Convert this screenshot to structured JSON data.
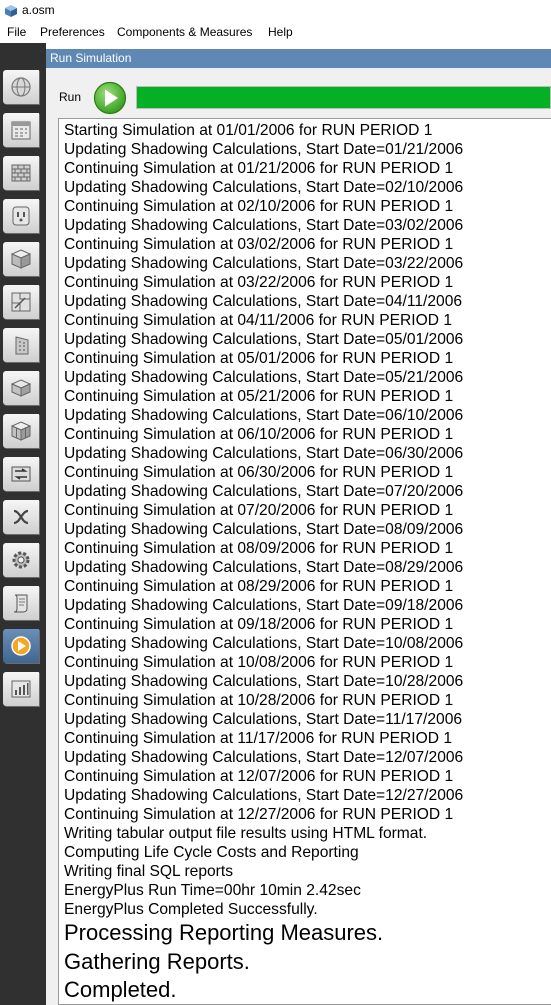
{
  "window": {
    "title": "a.osm",
    "icon": "openstudio-cube-icon"
  },
  "menubar": {
    "items": [
      "File",
      "Preferences",
      "Components & Measures",
      "Help"
    ]
  },
  "sidebar": {
    "items": [
      {
        "name": "site-tab",
        "icon": "globe-icon"
      },
      {
        "name": "schedules-tab",
        "icon": "calendar-icon"
      },
      {
        "name": "constructions-tab",
        "icon": "brick-wall-icon"
      },
      {
        "name": "loads-tab",
        "icon": "outlet-icon"
      },
      {
        "name": "space-types-tab",
        "icon": "space-type-cube-icon"
      },
      {
        "name": "geometry-tab",
        "icon": "floorplan-icon"
      },
      {
        "name": "facility-tab",
        "icon": "building-icon"
      },
      {
        "name": "spaces-tab",
        "icon": "space-cube-icon"
      },
      {
        "name": "thermal-zones-tab",
        "icon": "zone-cube-icon"
      },
      {
        "name": "hvac-systems-tab",
        "icon": "hvac-loop-icon"
      },
      {
        "name": "output-variables-tab",
        "icon": "variables-x-icon"
      },
      {
        "name": "simulation-settings-tab",
        "icon": "gear-icon"
      },
      {
        "name": "measures-tab",
        "icon": "scroll-icon"
      },
      {
        "name": "run-simulation-tab",
        "icon": "play-circle-icon",
        "active": true
      },
      {
        "name": "results-summary-tab",
        "icon": "bar-chart-icon"
      }
    ]
  },
  "panel": {
    "title": "Run Simulation"
  },
  "run": {
    "label": "Run",
    "button_icon": "play-icon",
    "progress_percent": 100,
    "progress_color": "#06b025"
  },
  "log": {
    "lines": [
      "Starting Simulation at 01/01/2006 for RUN PERIOD 1",
      "Updating Shadowing Calculations, Start Date=01/21/2006",
      "Continuing Simulation at 01/21/2006 for RUN PERIOD 1",
      "Updating Shadowing Calculations, Start Date=02/10/2006",
      "Continuing Simulation at 02/10/2006 for RUN PERIOD 1",
      "Updating Shadowing Calculations, Start Date=03/02/2006",
      "Continuing Simulation at 03/02/2006 for RUN PERIOD 1",
      "Updating Shadowing Calculations, Start Date=03/22/2006",
      "Continuing Simulation at 03/22/2006 for RUN PERIOD 1",
      "Updating Shadowing Calculations, Start Date=04/11/2006",
      "Continuing Simulation at 04/11/2006 for RUN PERIOD 1",
      "Updating Shadowing Calculations, Start Date=05/01/2006",
      "Continuing Simulation at 05/01/2006 for RUN PERIOD 1",
      "Updating Shadowing Calculations, Start Date=05/21/2006",
      "Continuing Simulation at 05/21/2006 for RUN PERIOD 1",
      "Updating Shadowing Calculations, Start Date=06/10/2006",
      "Continuing Simulation at 06/10/2006 for RUN PERIOD 1",
      "Updating Shadowing Calculations, Start Date=06/30/2006",
      "Continuing Simulation at 06/30/2006 for RUN PERIOD 1",
      "Updating Shadowing Calculations, Start Date=07/20/2006",
      "Continuing Simulation at 07/20/2006 for RUN PERIOD 1",
      "Updating Shadowing Calculations, Start Date=08/09/2006",
      "Continuing Simulation at 08/09/2006 for RUN PERIOD 1",
      "Updating Shadowing Calculations, Start Date=08/29/2006",
      "Continuing Simulation at 08/29/2006 for RUN PERIOD 1",
      "Updating Shadowing Calculations, Start Date=09/18/2006",
      "Continuing Simulation at 09/18/2006 for RUN PERIOD 1",
      "Updating Shadowing Calculations, Start Date=10/08/2006",
      "Continuing Simulation at 10/08/2006 for RUN PERIOD 1",
      "Updating Shadowing Calculations, Start Date=10/28/2006",
      "Continuing Simulation at 10/28/2006 for RUN PERIOD 1",
      "Updating Shadowing Calculations, Start Date=11/17/2006",
      "Continuing Simulation at 11/17/2006 for RUN PERIOD 1",
      "Updating Shadowing Calculations, Start Date=12/07/2006",
      "Continuing Simulation at 12/07/2006 for RUN PERIOD 1",
      "Updating Shadowing Calculations, Start Date=12/27/2006",
      "Continuing Simulation at 12/27/2006 for RUN PERIOD 1",
      "Writing tabular output file results using HTML format.",
      "Computing Life Cycle Costs and Reporting",
      "Writing final SQL reports",
      "EnergyPlus Run Time=00hr 10min  2.42sec",
      "EnergyPlus Completed Successfully."
    ],
    "large_lines": [
      "Processing Reporting Measures.",
      "Gathering Reports.",
      "Completed."
    ]
  }
}
